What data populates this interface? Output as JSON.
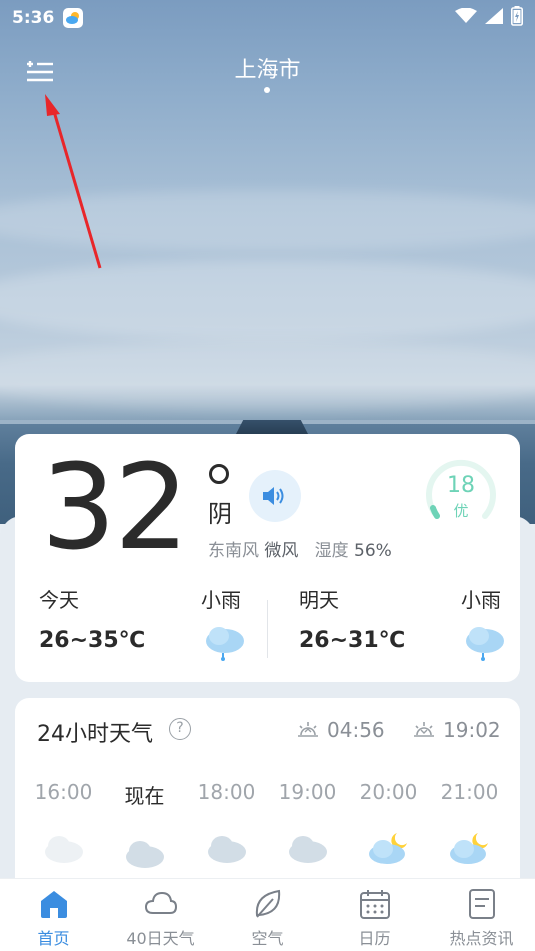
{
  "status_bar": {
    "time": "5:36"
  },
  "header": {
    "city": "上海市"
  },
  "current": {
    "temperature": "32",
    "condition": "阴",
    "wind_direction": "东南风",
    "wind_level": "微风",
    "humidity_label": "湿度",
    "humidity_value": "56%",
    "aqi_value": "18",
    "aqi_label": "优"
  },
  "forecast": {
    "today": {
      "name": "今天",
      "condition": "小雨",
      "range": "26~35℃"
    },
    "tomorrow": {
      "name": "明天",
      "condition": "小雨",
      "range": "26~31℃"
    }
  },
  "hourly": {
    "title": "24小时天气",
    "help": "?",
    "sunrise": "04:56",
    "sunset": "19:02",
    "hours": [
      {
        "label": "16:00",
        "icon": "cloudy-icon"
      },
      {
        "label": "现在",
        "icon": "cloudy-icon"
      },
      {
        "label": "18:00",
        "icon": "cloudy-icon"
      },
      {
        "label": "19:00",
        "icon": "cloudy-icon"
      },
      {
        "label": "20:00",
        "icon": "cloudy-night-icon"
      },
      {
        "label": "21:00",
        "icon": "cloudy-night-icon"
      }
    ]
  },
  "nav": {
    "items": [
      {
        "label": "首页",
        "icon": "home-icon",
        "active": true
      },
      {
        "label": "40日天气",
        "icon": "cloud-icon",
        "active": false
      },
      {
        "label": "空气",
        "icon": "leaf-icon",
        "active": false
      },
      {
        "label": "日历",
        "icon": "calendar-icon",
        "active": false
      },
      {
        "label": "热点资讯",
        "icon": "news-icon",
        "active": false
      }
    ]
  },
  "colors": {
    "accent": "#3b8de0",
    "aqi_good": "#6ed3b7",
    "annotation_arrow": "#e8262a"
  }
}
